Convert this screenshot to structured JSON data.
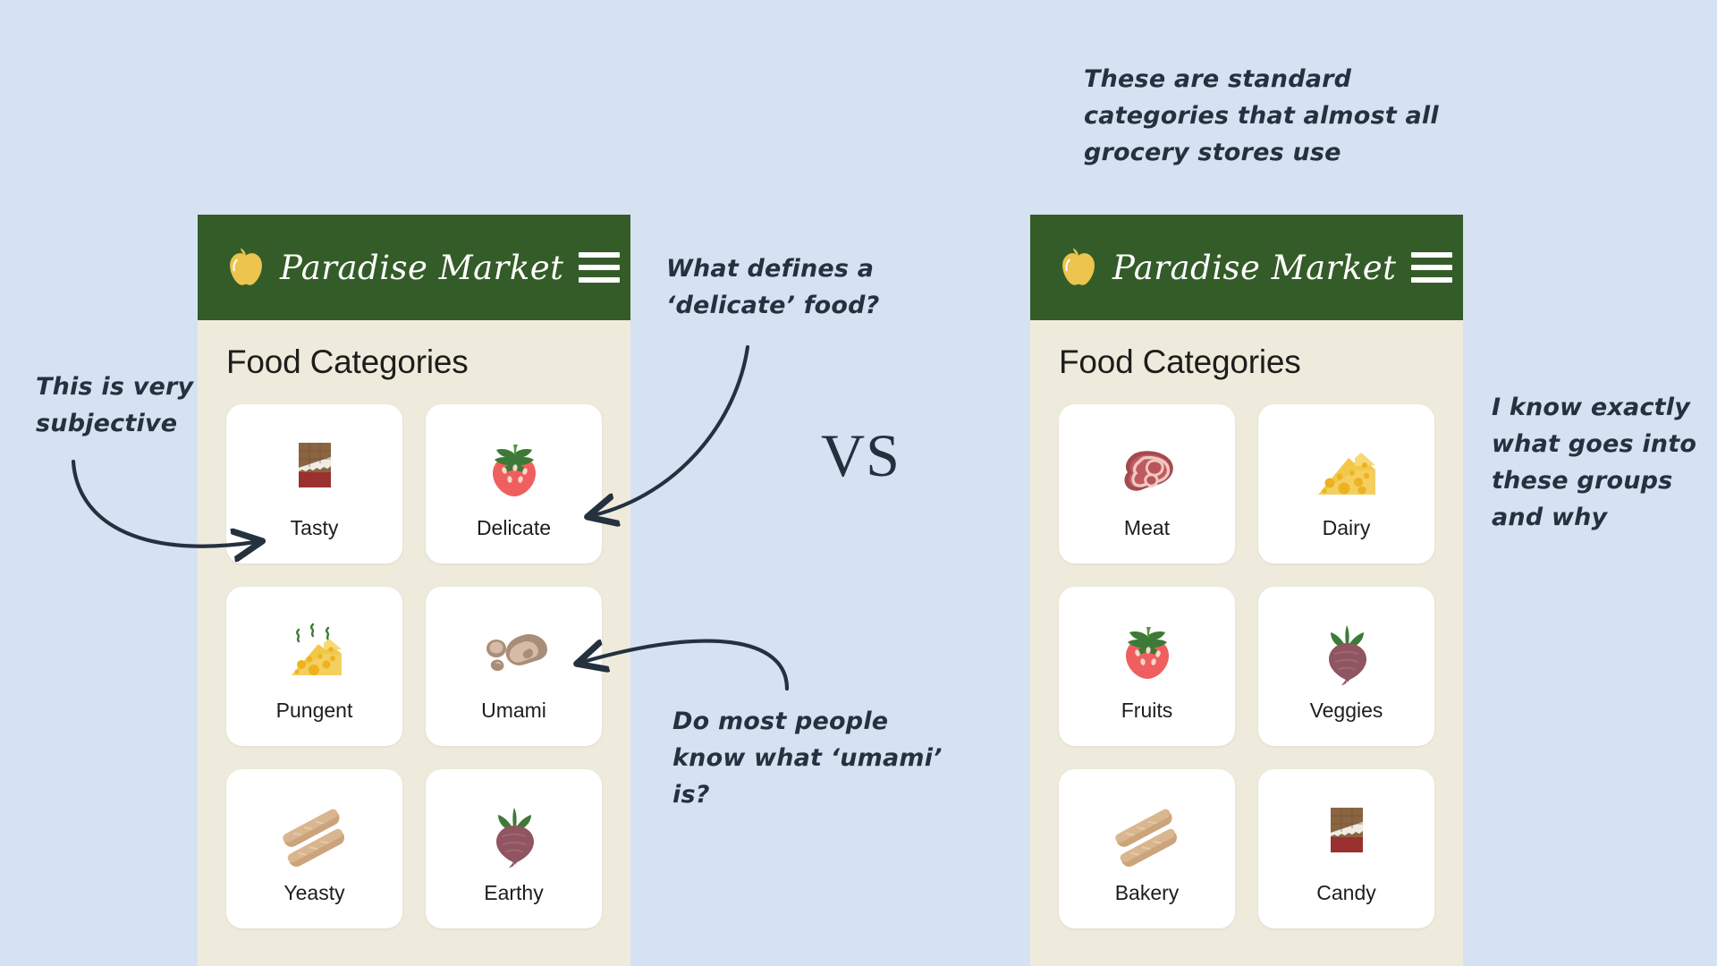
{
  "background_color": "#d6e2f2",
  "panel_background": "#efebdc",
  "header_color": "#345c29",
  "card_color": "#ffffff",
  "text_color": "#1d1d1d",
  "annotation_color": "#25313f",
  "comparison": {
    "vs_label": "VS"
  },
  "left_panel": {
    "brand": {
      "name": "Paradise Market",
      "apple_icon": "apple-icon"
    },
    "menu_icon": "hamburger-menu-icon",
    "section_title": "Food Categories",
    "categories": [
      {
        "label": "Tasty",
        "icon": "chocolate-bar-icon"
      },
      {
        "label": "Delicate",
        "icon": "strawberry-icon"
      },
      {
        "label": "Pungent",
        "icon": "stinky-cheese-icon"
      },
      {
        "label": "Umami",
        "icon": "mushroom-icon"
      },
      {
        "label": "Yeasty",
        "icon": "baguette-bread-icon"
      },
      {
        "label": "Earthy",
        "icon": "beet-icon"
      }
    ]
  },
  "right_panel": {
    "brand": {
      "name": "Paradise Market",
      "apple_icon": "apple-icon"
    },
    "menu_icon": "hamburger-menu-icon",
    "section_title": "Food Categories",
    "categories": [
      {
        "label": "Meat",
        "icon": "steak-icon"
      },
      {
        "label": "Dairy",
        "icon": "cheese-wedge-icon"
      },
      {
        "label": "Fruits",
        "icon": "strawberry-icon"
      },
      {
        "label": "Veggies",
        "icon": "beet-icon"
      },
      {
        "label": "Bakery",
        "icon": "baguette-bread-icon"
      },
      {
        "label": "Candy",
        "icon": "chocolate-bar-icon"
      }
    ]
  },
  "annotations": {
    "subjective": "This is very subjective",
    "delicate": "What defines a ‘delicate’ food?",
    "standard": "These are standard categories that almost all grocery stores use",
    "exactly": "I know exactly what goes into these groups and why",
    "umami": "Do most people know what ‘umami’ is?"
  }
}
